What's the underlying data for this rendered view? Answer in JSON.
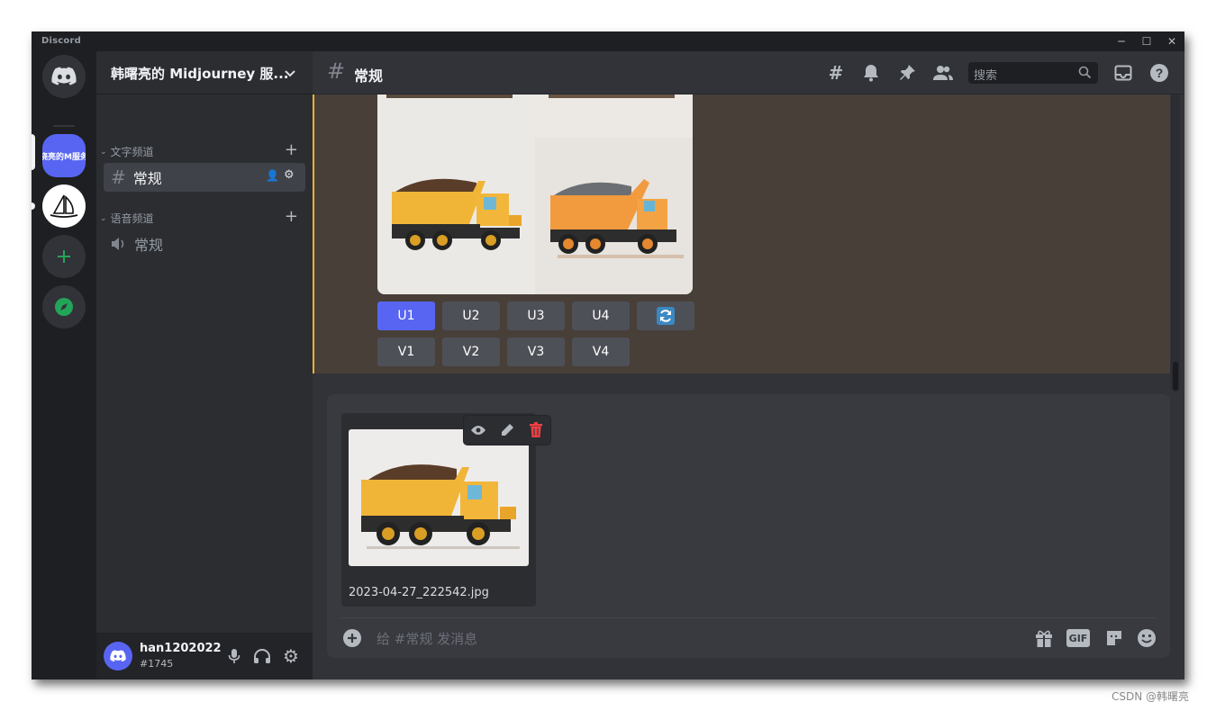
{
  "window": {
    "app_name": "Discord"
  },
  "servers": [
    {
      "label": "晓亮的M服务"
    }
  ],
  "guild": {
    "name": "韩曙亮的 Midjourney 服..."
  },
  "categories": [
    {
      "name": "文字频道",
      "channels": [
        {
          "name": "常规"
        }
      ]
    },
    {
      "name": "语音频道",
      "channels": [
        {
          "name": "常规"
        }
      ]
    }
  ],
  "user": {
    "name": "han1202022",
    "tag": "#1745"
  },
  "header": {
    "channel_name": "常规",
    "search_placeholder": "搜索"
  },
  "message": {
    "upscale_buttons": [
      "U1",
      "U2",
      "U3",
      "U4"
    ],
    "variation_buttons": [
      "V1",
      "V2",
      "V3",
      "V4"
    ]
  },
  "composer": {
    "attachment_filename": "2023-04-27_222542.jpg",
    "placeholder": "给 #常规 发消息",
    "gif_label": "GIF"
  },
  "colors": {
    "accent": "#5865f2",
    "highlight_bar": "#f0b232",
    "delete": "#f23f43",
    "green": "#23a559"
  },
  "watermark": "CSDN @韩曙亮"
}
